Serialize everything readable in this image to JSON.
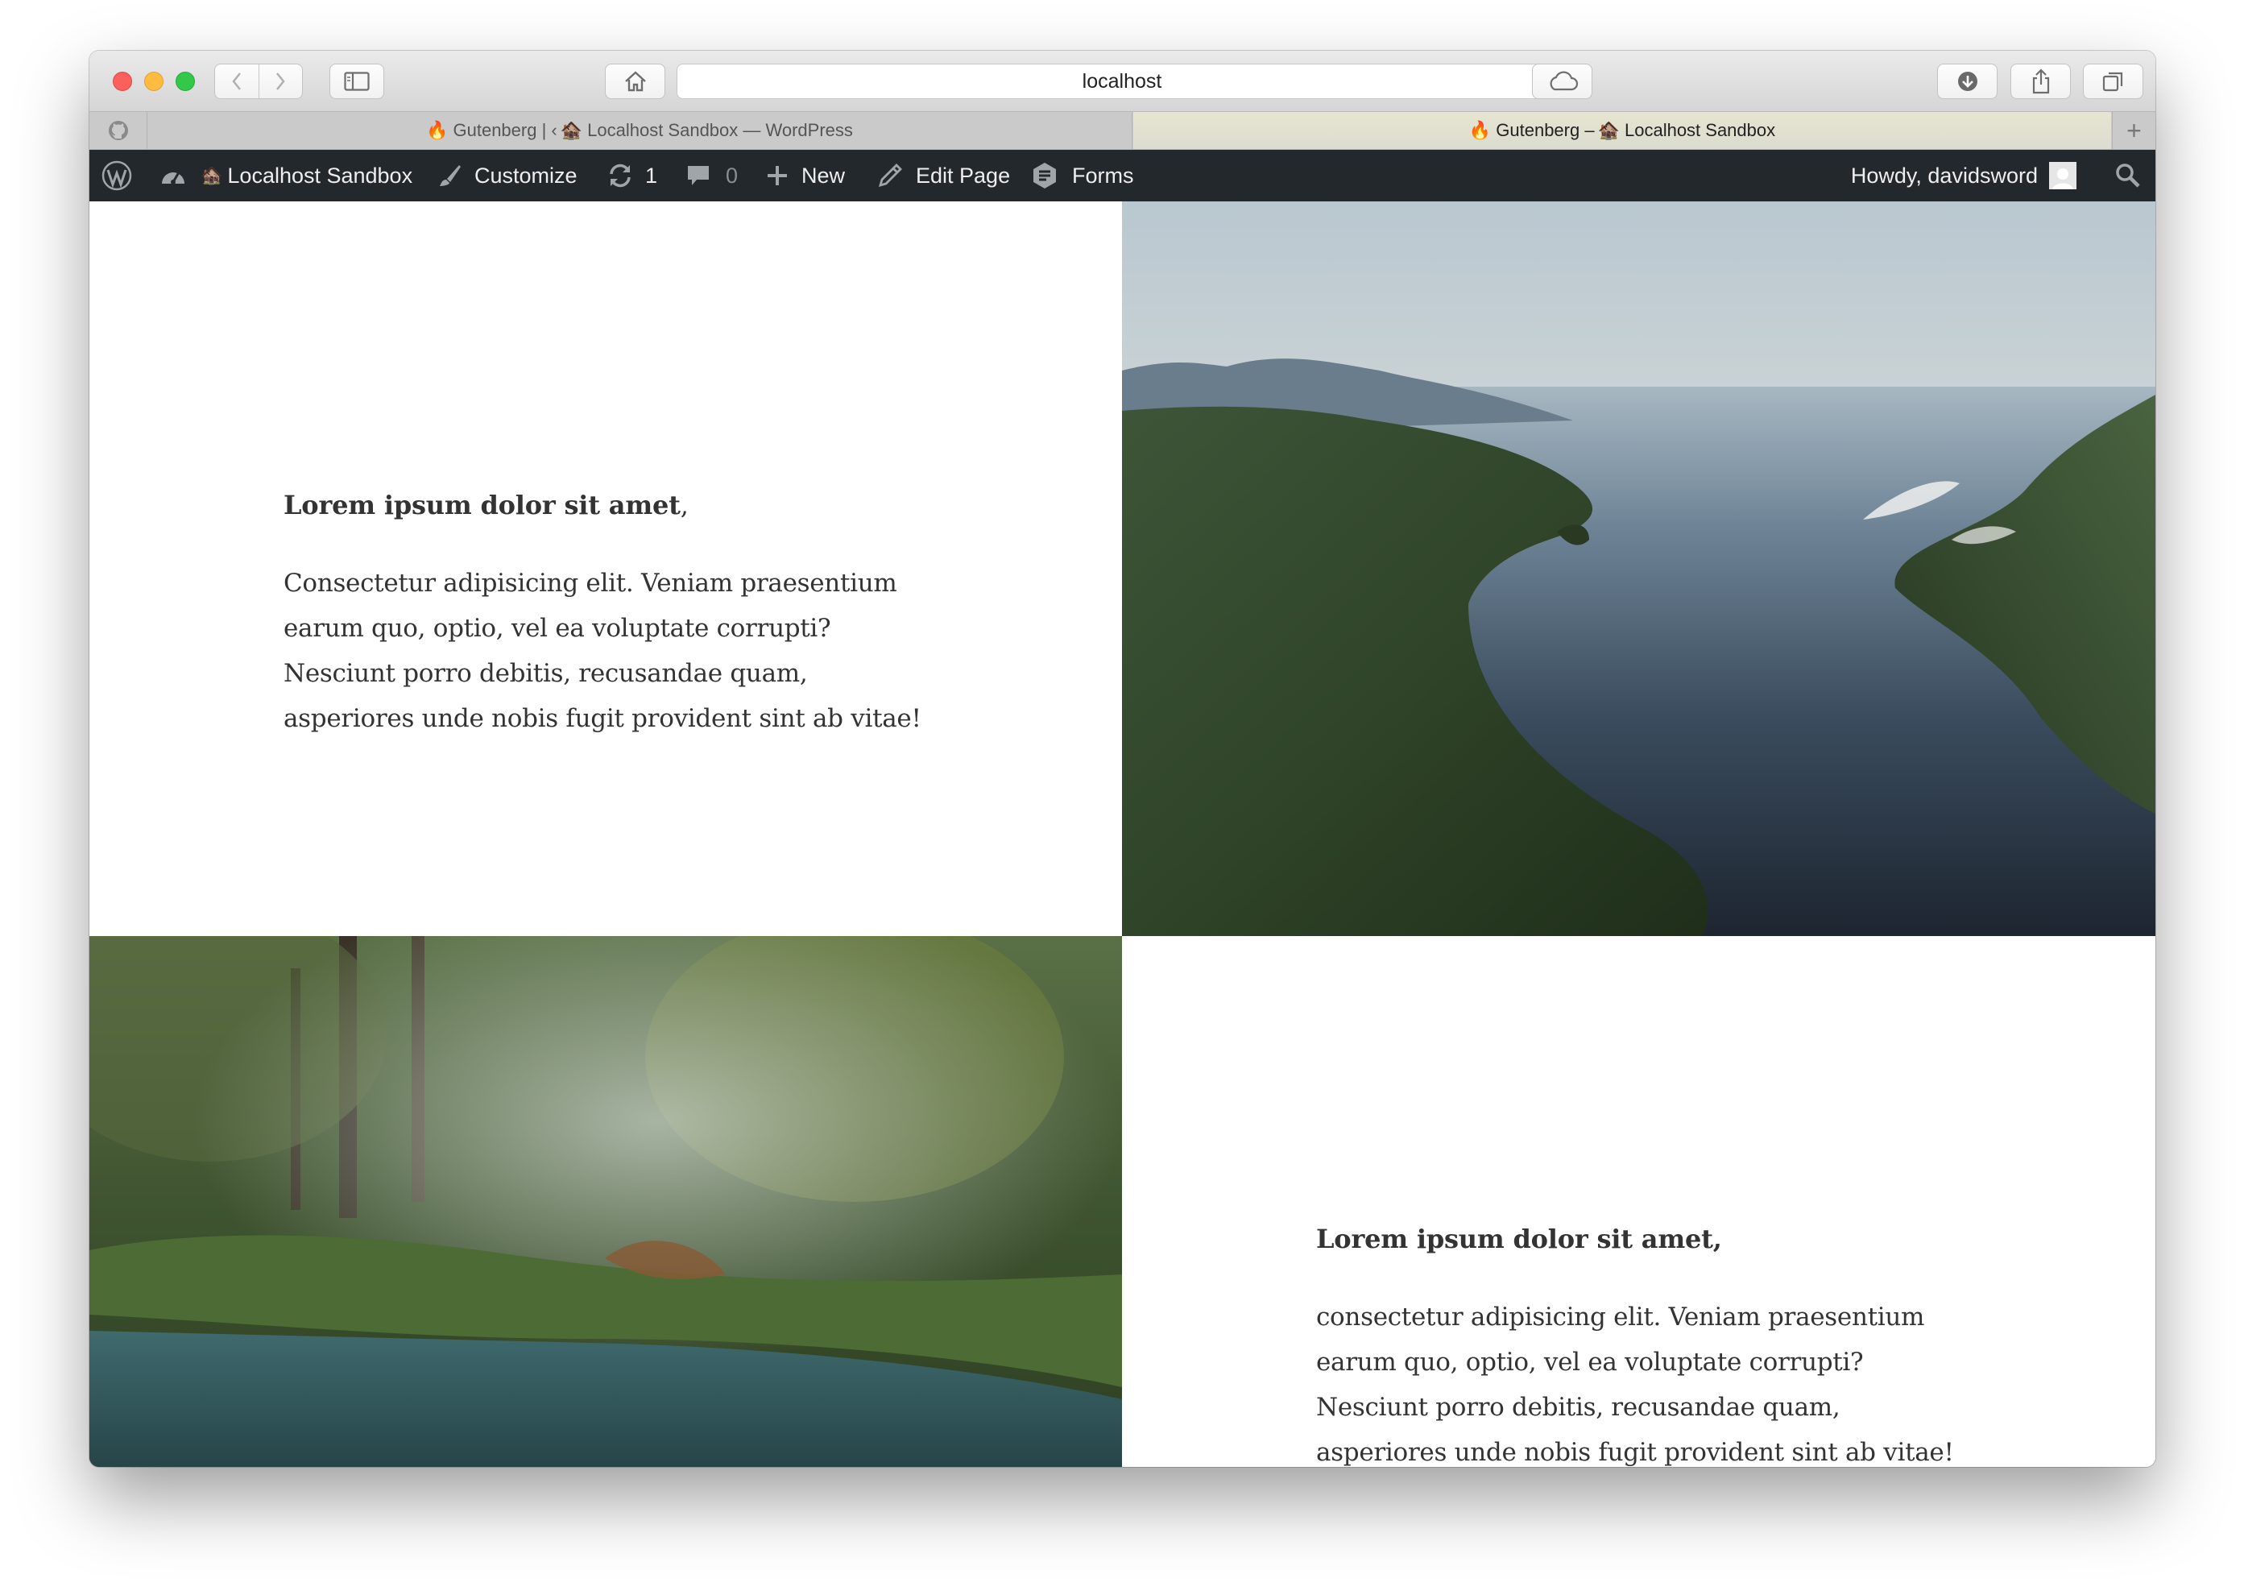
{
  "browser": {
    "url": "localhost",
    "tabs": [
      {
        "favicon": "🔥",
        "text": "Gutenberg | ‹ ",
        "site_icon": "🏚️",
        "text2": "Localhost Sandbox — WordPress"
      },
      {
        "favicon": "🔥",
        "text": "Gutenberg – ",
        "site_icon": "🏚️",
        "text2": "Localhost Sandbox"
      }
    ],
    "pinned_tab_icon": "github-icon",
    "new_tab_label": "+"
  },
  "adminbar": {
    "site_name": "Localhost Sandbox",
    "customize": "Customize",
    "updates_count": "1",
    "comments_count": "0",
    "new": "New",
    "edit_page": "Edit Page",
    "forms": "Forms",
    "greeting": "Howdy, davidsword",
    "background": "#23282d"
  },
  "content": {
    "block1": {
      "heading": "Lorem ipsum dolor sit amet",
      "heading_suffix": ",",
      "body": "Consectetur adipisicing elit. Veniam praesentium earum quo, optio, vel ea voluptate corrupti? Nesciunt porro debitis, recusandae quam, asperiores unde nobis fugit provident sint ab vitae!"
    },
    "block2": {
      "heading": "Lorem ipsum dolor sit amet,",
      "body": "consectetur adipisicing elit. Veniam praesentium earum quo, optio, vel ea voluptate corrupti? Nesciunt porro debitis, recusandae quam, asperiores unde nobis fugit provident sint ab vitae!"
    },
    "images": [
      "aerial-fjord-photo",
      "misty-forest-river-photo"
    ]
  }
}
